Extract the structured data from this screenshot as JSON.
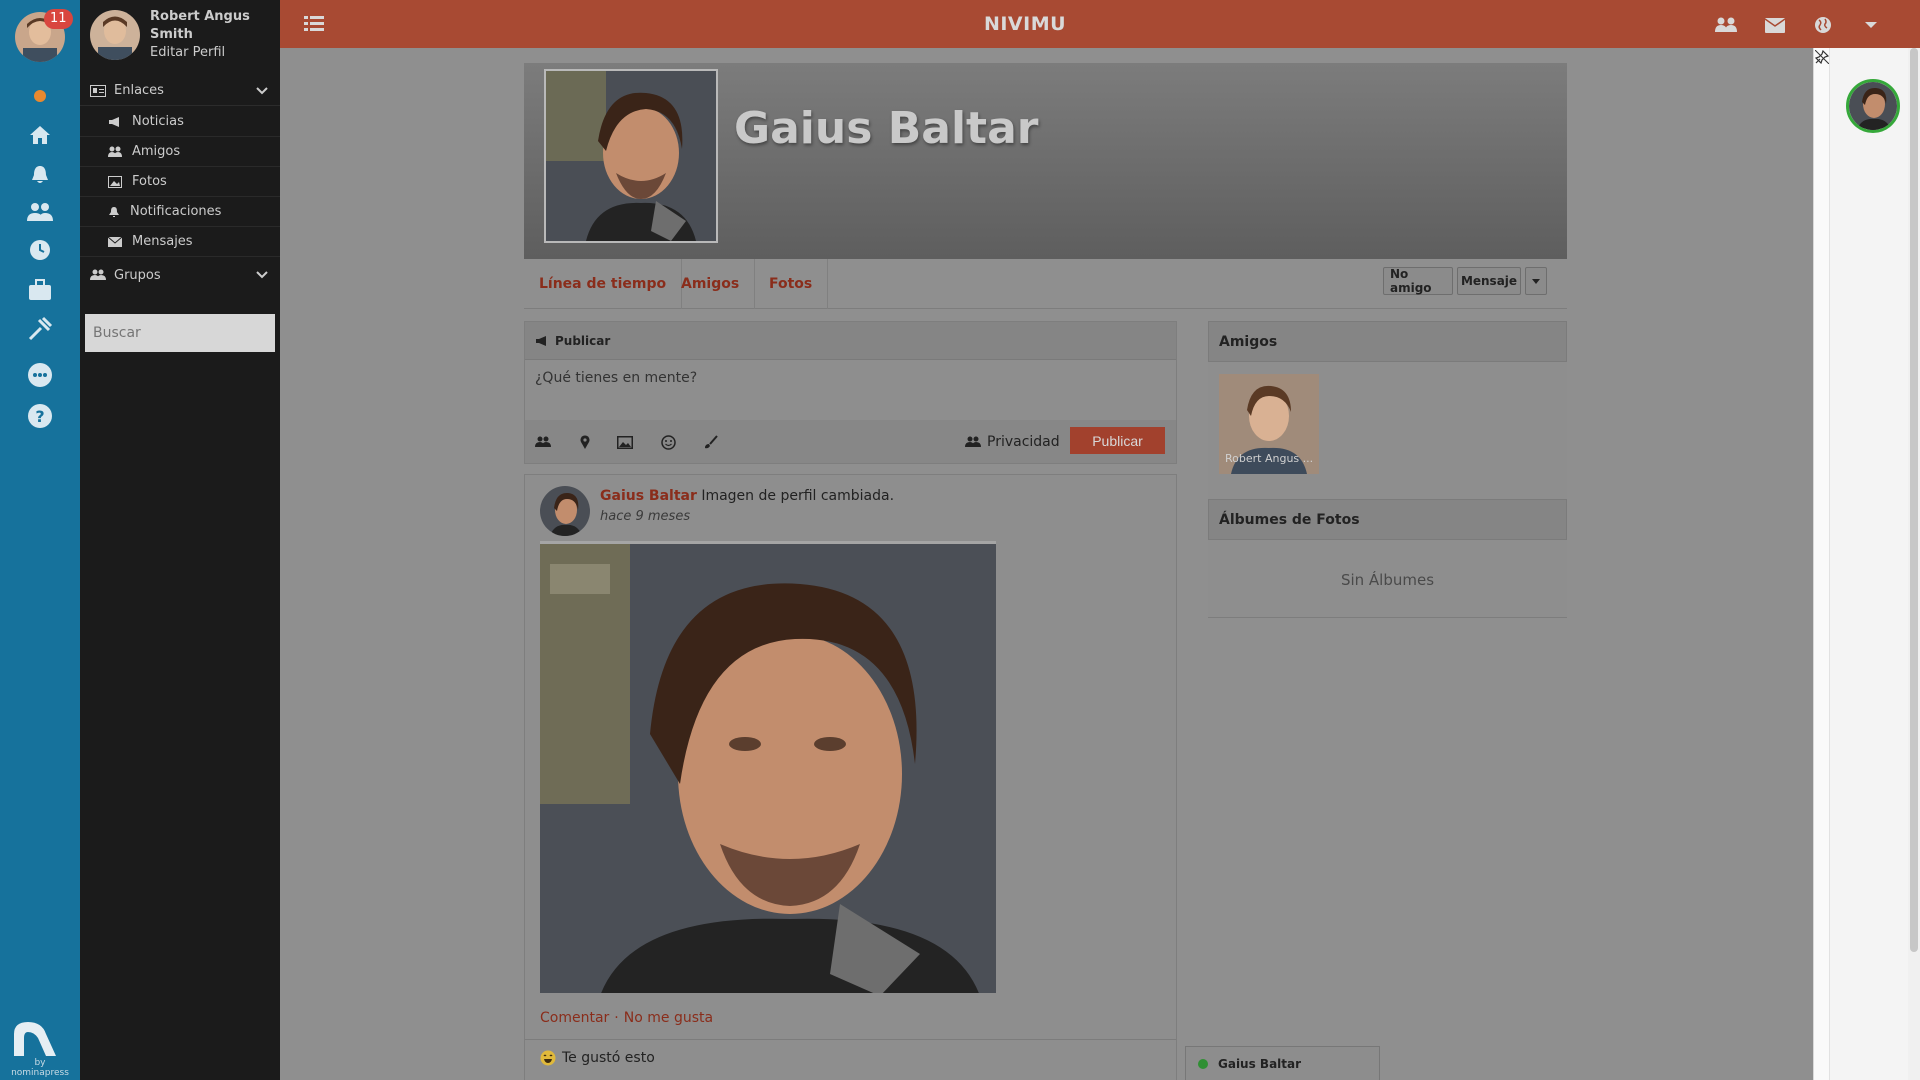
{
  "app": {
    "title": "NIVIMU"
  },
  "rail": {
    "notification_count": "11",
    "icons": [
      "user-avatar",
      "status-dot-icon",
      "home-icon",
      "bell-icon",
      "users-icon",
      "clock-icon",
      "briefcase-icon",
      "tools-icon",
      "chat-bubble-icon",
      "help-icon"
    ],
    "brand_text": "by nominapress"
  },
  "sidebar": {
    "user_name": "Robert Angus Smith",
    "edit_profile": "Editar Perfil",
    "links_section": "Enlaces",
    "items": [
      {
        "label": "Noticias",
        "icon": "bullhorn-icon"
      },
      {
        "label": "Amigos",
        "icon": "users-icon"
      },
      {
        "label": "Fotos",
        "icon": "image-icon"
      },
      {
        "label": "Notificaciones",
        "icon": "bell-icon"
      },
      {
        "label": "Mensajes",
        "icon": "envelope-icon"
      }
    ],
    "groups_section": "Grupos",
    "search_placeholder": "Buscar"
  },
  "topbar": {
    "icons": [
      "list-icon",
      "users-icon",
      "envelope-icon",
      "globe-icon",
      "caret-down-icon"
    ]
  },
  "profile": {
    "name": "Gaius Baltar",
    "tabs": [
      "Línea de tiempo",
      "Amigos",
      "Fotos"
    ],
    "actions": {
      "unfriend": "No amigo",
      "message": "Mensaje"
    }
  },
  "composer": {
    "title": "Publicar",
    "placeholder": "¿Qué tienes en mente?",
    "tools": [
      "users-icon",
      "map-pin-icon",
      "image-icon",
      "smile-icon",
      "brush-icon"
    ],
    "privacy": "Privacidad",
    "submit": "Publicar"
  },
  "post": {
    "author": "Gaius Baltar",
    "text": "Imagen de perfil cambiada.",
    "time": "hace 9 meses",
    "comment": "Comentar",
    "separator": "·",
    "unlike": "No me gusta",
    "likes_text": "Te gustó esto"
  },
  "friends_card": {
    "title": "Amigos",
    "friend_name": "Robert Angus ..."
  },
  "albums_card": {
    "title": "Álbumes de Fotos",
    "empty": "Sin Álbumes"
  },
  "chat": {
    "name": "Gaius Baltar",
    "status_color": "#2f8f33"
  },
  "colors": {
    "rail": "#16729c",
    "topbar": "#a84a33",
    "accent": "#8a2d1b",
    "online": "#35a83a"
  }
}
